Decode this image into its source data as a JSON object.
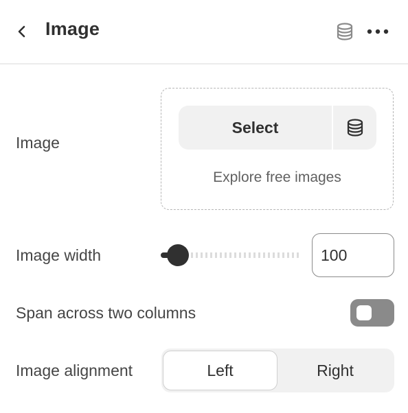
{
  "header": {
    "title": "Image",
    "back_icon": "chevron-left-icon",
    "database_icon": "database-icon",
    "more_icon": "more-horizontal-icon"
  },
  "image_setting": {
    "label": "Image",
    "select_label": "Select",
    "select_icon": "database-icon",
    "explore_label": "Explore free images"
  },
  "image_width": {
    "label": "Image width",
    "value": "100",
    "slider_fraction": 0.13
  },
  "span_columns": {
    "label": "Span across two columns",
    "enabled": false
  },
  "image_alignment": {
    "label": "Image alignment",
    "options": [
      "Left",
      "Right"
    ],
    "selected": "Left"
  },
  "colors": {
    "text": "#303030",
    "toggle_off": "#8a8a8a",
    "surface": "#f1f1f1"
  }
}
